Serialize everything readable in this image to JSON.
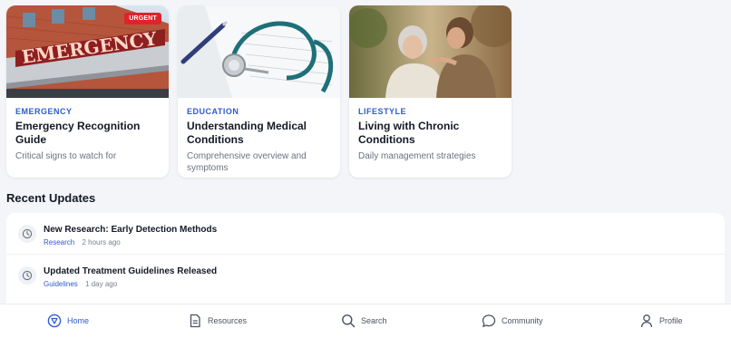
{
  "cards": [
    {
      "category": "EMERGENCY",
      "title": "Emergency Recognition Guide",
      "description": "Critical signs to watch for",
      "badge": "URGENT",
      "sign_text": "EMERGENCY"
    },
    {
      "category": "EDUCATION",
      "title": "Understanding Medical Conditions",
      "description": "Comprehensive overview and symptoms"
    },
    {
      "category": "LIFESTYLE",
      "title": "Living with Chronic Conditions",
      "description": "Daily management strategies"
    }
  ],
  "recent_updates": {
    "title": "Recent Updates",
    "items": [
      {
        "title": "New Research: Early Detection Methods",
        "tag": "Research",
        "time": "2 hours ago"
      },
      {
        "title": "Updated Treatment Guidelines Released",
        "tag": "Guidelines",
        "time": "1 day ago"
      }
    ]
  },
  "nav": {
    "items": [
      {
        "label": "Home",
        "icon": "home-icon",
        "active": true
      },
      {
        "label": "Resources",
        "icon": "document-icon"
      },
      {
        "label": "Search",
        "icon": "search-icon"
      },
      {
        "label": "Community",
        "icon": "chat-icon"
      },
      {
        "label": "Profile",
        "icon": "user-icon"
      }
    ]
  },
  "colors": {
    "accent": "#2f5bd0",
    "urgent": "#e0222b",
    "background": "#f3f5f8"
  }
}
